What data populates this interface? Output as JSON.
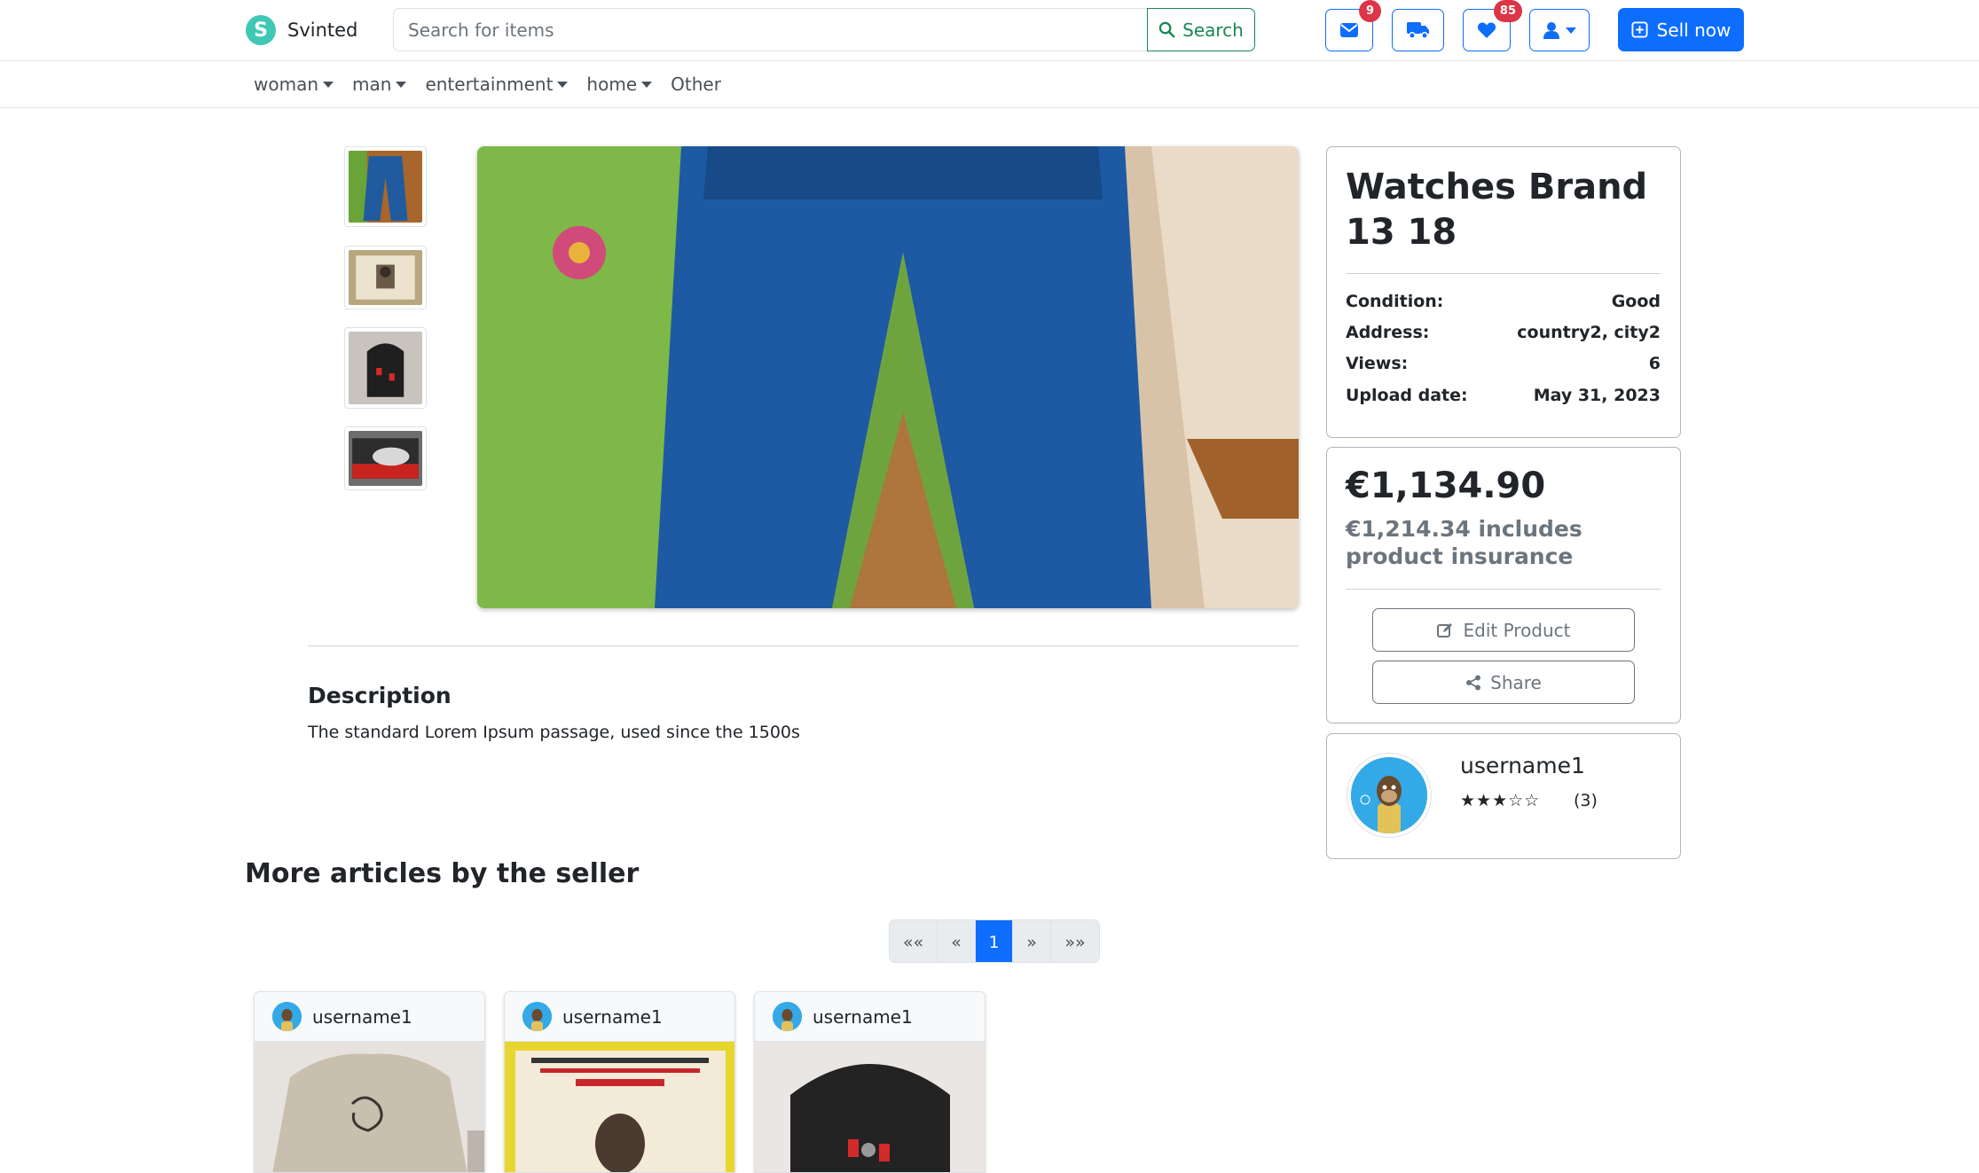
{
  "brand": {
    "logo_letter": "S",
    "name": "Svinted"
  },
  "search": {
    "placeholder": "Search for items",
    "button_label": "Search"
  },
  "header_icons": {
    "messages": {
      "icon": "envelope-icon",
      "badge": "9"
    },
    "orders": {
      "icon": "truck-icon"
    },
    "favorites": {
      "icon": "heart-icon",
      "badge": "85"
    },
    "account": {
      "icon": "user-icon"
    }
  },
  "sell_button": {
    "label": "Sell now",
    "icon": "plus-square-icon"
  },
  "categories": [
    {
      "label": "woman",
      "dropdown": true
    },
    {
      "label": "man",
      "dropdown": true
    },
    {
      "label": "entertainment",
      "dropdown": true
    },
    {
      "label": "home",
      "dropdown": true
    },
    {
      "label": "Other",
      "dropdown": false
    }
  ],
  "product": {
    "title": "Watches Brand 13 18",
    "details": [
      {
        "label": "Condition:",
        "value": "Good"
      },
      {
        "label": "Address:",
        "value": "country2, city2"
      },
      {
        "label": "Views:",
        "value": "6"
      },
      {
        "label": "Upload date:",
        "value": "May 31, 2023"
      }
    ],
    "price": "€1,134.90",
    "price_with_insurance": "€1,214.34 includes product insurance",
    "edit_label": "Edit Product",
    "share_label": "Share",
    "description_title": "Description",
    "description": "The standard Lorem Ipsum passage, used since the 1500s"
  },
  "seller": {
    "username": "username1",
    "stars": "★★★☆☆",
    "rating": 3,
    "review_count": "(3)"
  },
  "more_articles": {
    "title": "More articles by the seller",
    "pagination": {
      "first": "««",
      "prev": "«",
      "current": "1",
      "next": "»",
      "last": "»»"
    },
    "cards": [
      {
        "username": "username1"
      },
      {
        "username": "username1"
      },
      {
        "username": "username1"
      }
    ]
  },
  "colors": {
    "primary": "#0d6efd",
    "success": "#198754",
    "danger": "#dc3545",
    "brand": "#3fc8b3",
    "muted": "#6c757d"
  }
}
